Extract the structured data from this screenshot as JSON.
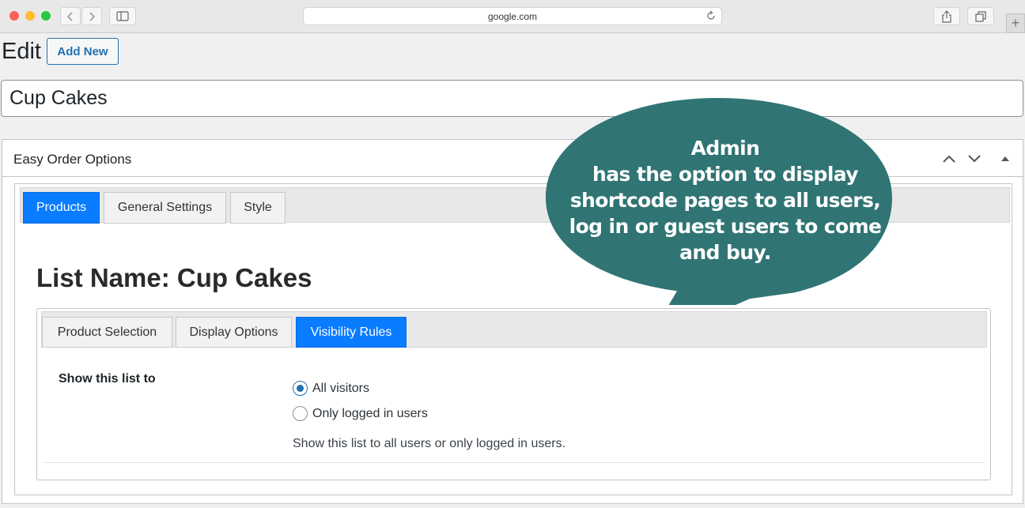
{
  "browser": {
    "url": "google.com"
  },
  "page": {
    "heading": "Edit",
    "add_new_label": "Add New",
    "title_value": "Cup Cakes"
  },
  "metabox": {
    "title": "Easy Order Options",
    "tabs": [
      {
        "label": "Products",
        "active": true
      },
      {
        "label": "General Settings",
        "active": false
      },
      {
        "label": "Style",
        "active": false
      }
    ],
    "list_name": "List Name: Cup Cakes",
    "sub_tabs": [
      {
        "label": "Product Selection",
        "active": false
      },
      {
        "label": "Display Options",
        "active": false
      },
      {
        "label": "Visibility Rules",
        "active": true
      }
    ],
    "visibility": {
      "field_label": "Show this list to",
      "options": [
        {
          "label": "All visitors",
          "checked": true
        },
        {
          "label": "Only logged in users",
          "checked": false
        }
      ],
      "description": "Show this list to all users or only logged in users."
    }
  },
  "callout": {
    "lines": [
      "Admin",
      "has the option to display",
      "shortcode pages to all users,",
      "log in or guest users to come",
      "and buy."
    ],
    "color": "#307474"
  },
  "colors": {
    "active_tab": "#0a7cff",
    "link_blue": "#2271b1"
  }
}
